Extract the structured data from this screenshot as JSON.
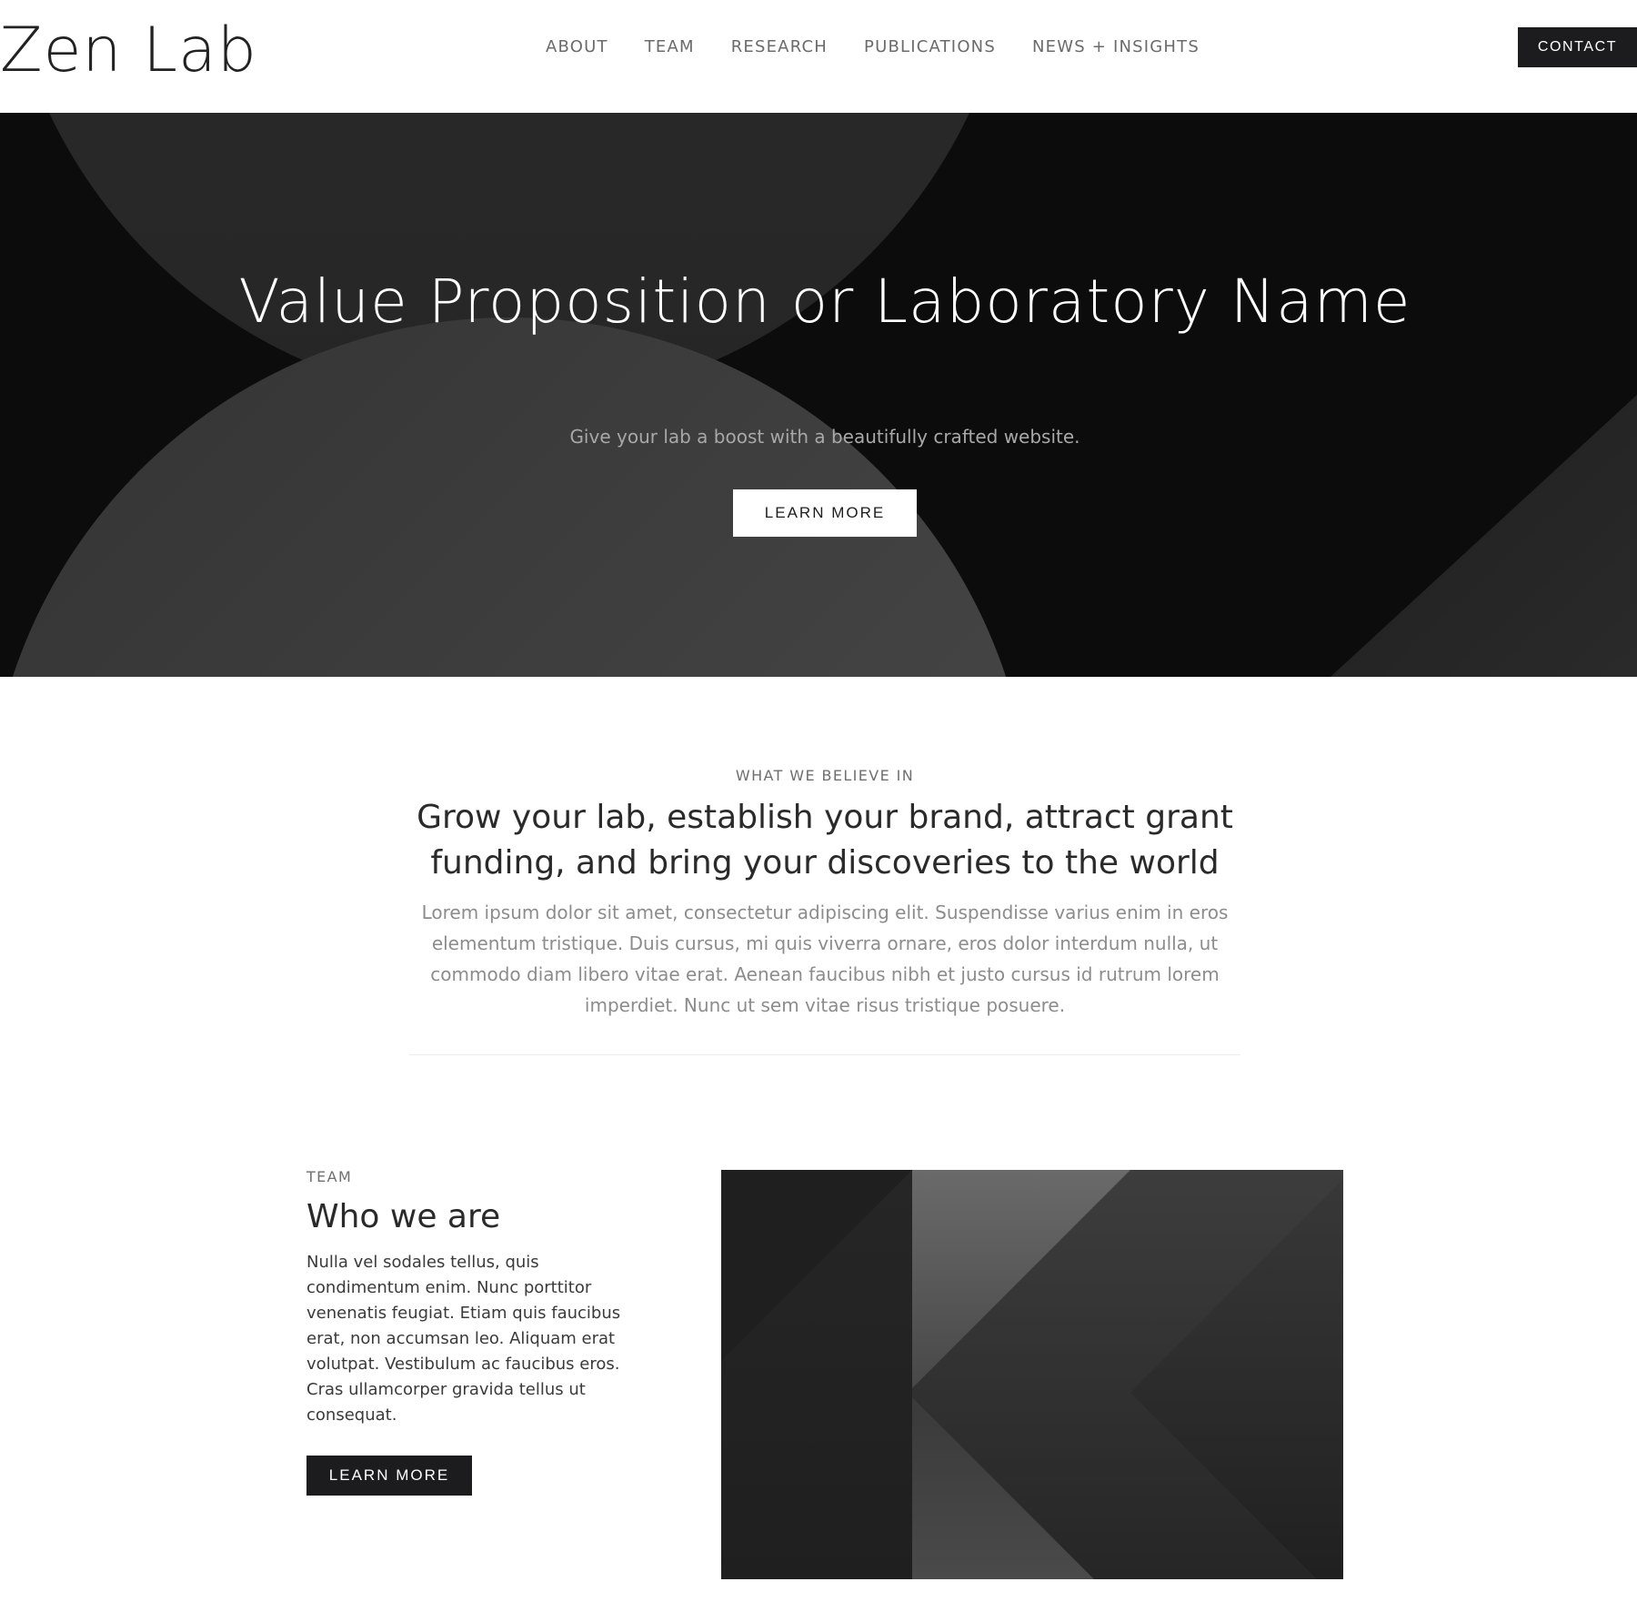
{
  "header": {
    "logo": "Zen Lab",
    "nav": [
      "ABOUT",
      "TEAM",
      "RESEARCH",
      "PUBLICATIONS",
      "NEWS + INSIGHTS"
    ],
    "contact_label": "CONTACT"
  },
  "hero": {
    "title": "Value Proposition or Laboratory Name",
    "subtitle": "Give your lab a boost with a beautifully crafted website.",
    "button_label": "LEARN MORE"
  },
  "belief": {
    "eyebrow": "WHAT WE BELIEVE IN",
    "heading": "Grow your lab, establish your brand, attract grant funding, and bring your discoveries to the world",
    "body": "Lorem ipsum dolor sit amet, consectetur adipiscing elit. Suspendisse varius enim in eros elementum tristique. Duis cursus, mi quis viverra ornare, eros dolor interdum nulla, ut commodo diam libero vitae erat. Aenean faucibus nibh et justo cursus id rutrum lorem imperdiet. Nunc ut sem vitae risus tristique posuere."
  },
  "team": {
    "eyebrow": "TEAM",
    "heading": "Who we are",
    "body": "Nulla vel sodales tellus, quis condimentum enim. Nunc porttitor venenatis feugiat. Etiam quis faucibus erat, non accumsan leo. Aliquam erat volutpat. Vestibulum ac faucibus eros. Cras ullamcorper gravida tellus ut consequat.",
    "button_label": "LEARN MORE"
  },
  "colors": {
    "dark_button": "#1c1c1e",
    "hero_background": "#0b0b0b",
    "muted_text": "#8c8c8c"
  }
}
